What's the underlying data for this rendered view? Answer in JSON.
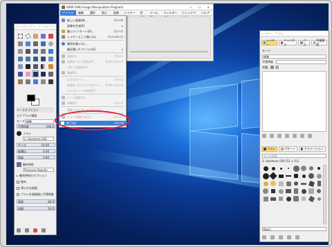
{
  "main_window": {
    "title": "GIMP (GNU Image Manipulation Program)",
    "menus": [
      {
        "label": "ファイル(F)"
      },
      {
        "label": "編集(E)"
      },
      {
        "label": "選択(S)"
      },
      {
        "label": "表示(V)"
      },
      {
        "label": "画像(I)"
      },
      {
        "label": "レイヤー(L)"
      },
      {
        "label": "色(C)"
      },
      {
        "label": "ツール(T)"
      },
      {
        "label": "フィルター(R)"
      },
      {
        "label": "ウィンドウ(W)"
      },
      {
        "label": "ヘルプ(H)"
      }
    ],
    "controls": {
      "minimize": "—",
      "maximize": "☐",
      "close": "✕"
    }
  },
  "file_menu": {
    "items": [
      {
        "label": "新しい画像(N)...",
        "shortcut": "Ctrl+N",
        "disabled": false
      },
      {
        "label": "画像を生成(E)",
        "shortcut": "▸",
        "disabled": false
      },
      {
        "label": "開く/インポート(O)...",
        "shortcut": "Ctrl+O",
        "disabled": false
      },
      {
        "label": "レイヤーとして開く(L)...",
        "shortcut": "Ctrl+Alt+O",
        "disabled": false
      },
      {
        "label": "場所を開く(L)...",
        "shortcut": "",
        "disabled": false
      },
      {
        "label": "最近開いたファイル(E)",
        "shortcut": "▸",
        "disabled": false
      },
      {
        "label": "保存(S)",
        "shortcut": "Ctrl+S",
        "disabled": true
      },
      {
        "label": "名前をつけて保存(A)...",
        "shortcut": "Shift+Ctrl+S",
        "disabled": true
      },
      {
        "label": "コピーを保存(Y)...",
        "shortcut": "",
        "disabled": true
      },
      {
        "label": "復帰(R)",
        "shortcut": "",
        "disabled": true
      },
      {
        "label": "エクスポート...",
        "shortcut": "Ctrl+E",
        "disabled": true
      },
      {
        "label": "名前をつけてエクスポート...",
        "shortcut": "Shift+Ctrl+E",
        "disabled": true
      },
      {
        "label": "テンプレートの作成(T)...",
        "shortcut": "",
        "disabled": true
      },
      {
        "label": "ページ設定(U)",
        "shortcut": "",
        "disabled": true
      },
      {
        "label": "印刷(P)...",
        "shortcut": "Ctrl+P",
        "disabled": true
      },
      {
        "label": "画面フォルダーのプロパティ",
        "shortcut": "",
        "disabled": true
      },
      {
        "label": "ビューを閉じる(C)",
        "shortcut": "Ctrl+W",
        "disabled": true
      },
      {
        "label": "すべて閉じる",
        "shortcut": "Shift+Ctrl+W",
        "disabled": true
      },
      {
        "label": "終了(Q)",
        "shortcut": "Ctrl+Q",
        "disabled": false,
        "highlighted": true
      }
    ]
  },
  "toolbox": {
    "title": "ツールボックス - ツールオプション",
    "options_tab": "ツールオプション",
    "tool_name": "エアブラシ/描画",
    "mode_label": "モード",
    "mode_value": "標準",
    "opacity_label": "不透明度",
    "opacity_value": "100.0",
    "brush_label": "ブラシ",
    "brush_value": "2. Hardness 050",
    "size_label": "サイズ",
    "size_value": "20.00",
    "aspect_label": "縦横比",
    "aspect_value": "0.00",
    "angle_label": "角度",
    "angle_value": "0.00",
    "dynamics_label": "動的特性",
    "dynamics_value": "Pressure Opacity",
    "dyn_opts": "動的特性のオプション",
    "jitter": "散布",
    "smooth": "滑らかな描画",
    "incremental": "ブラシを描画後に不透明度",
    "rate_label": "速度",
    "rate_value": "80.0",
    "flow_label": "流量",
    "flow_value": "10.0"
  },
  "dock": {
    "title": "レイヤー - ブラシ",
    "tabs": [
      "レイヤー",
      "チャンネル",
      "パス",
      "作業履歴"
    ],
    "mode_label": "モード",
    "mode_value": "標準",
    "opacity_label": "不透明度",
    "lock_label": "保護:",
    "brush_tabs": [
      "ブラシ",
      "パターン",
      "グラデーション"
    ],
    "filter_label": "タグの検索",
    "brush_name": "2. Hardness 050 (51 × 51)",
    "bottom_filter": "Basic,"
  }
}
